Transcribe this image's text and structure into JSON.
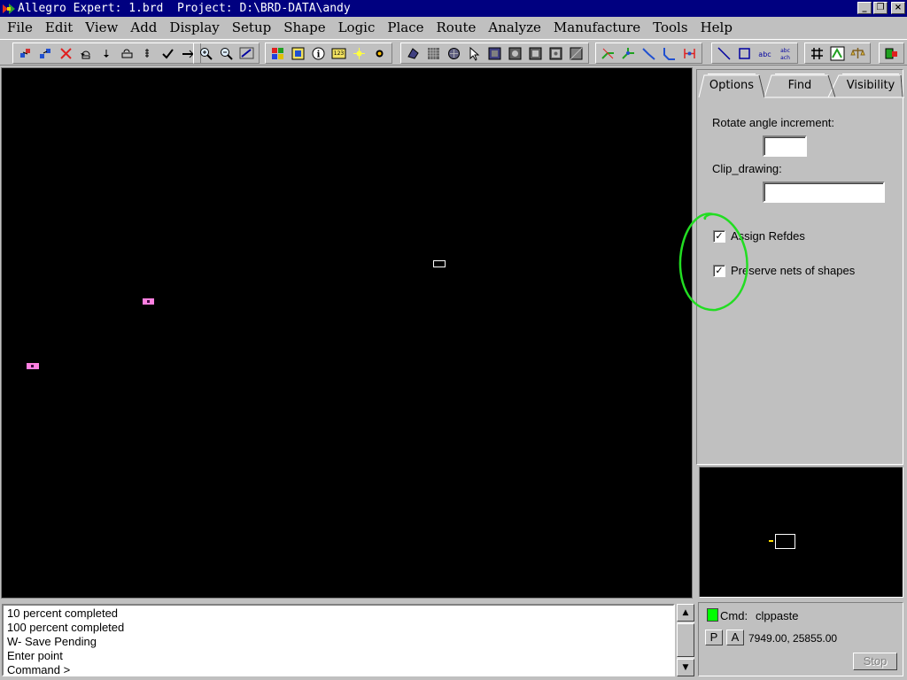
{
  "window": {
    "title": "Allegro Expert: 1.brd  Project: D:\\BRD-DATA\\andy",
    "controls": [
      "_",
      "❐",
      "×"
    ]
  },
  "menu": [
    "File",
    "Edit",
    "View",
    "Add",
    "Display",
    "Setup",
    "Shape",
    "Logic",
    "Place",
    "Route",
    "Analyze",
    "Manufacture",
    "Tools",
    "Help"
  ],
  "toolbar": {
    "groups": [
      [
        "move-icon",
        "copy-icon",
        "delete-icon",
        "undo-icon",
        "redo-icon",
        "undo-list-icon",
        "redo-list-icon",
        "done-icon",
        "next-icon"
      ],
      [
        "zoom-in-icon",
        "zoom-out-icon",
        "zoom-fit-icon"
      ],
      [
        "color-icon",
        "layers-icon",
        "info-icon",
        "measure-icon",
        "highlight-icon",
        "dehighlight-icon"
      ],
      [
        "shape-icon",
        "grid-icon",
        "via-icon",
        "select-icon",
        "fill-icon",
        "void-icon",
        "void-rect-icon",
        "void-circle-icon",
        "merge-icon"
      ],
      [
        "route-icon",
        "fanout-icon",
        "connect-icon",
        "slide-icon",
        "spread-icon"
      ],
      [
        "line-icon",
        "rect-icon",
        "text-icon",
        "text-edit-icon"
      ],
      [
        "grid-toggle-icon",
        "drc-icon",
        "scale-icon"
      ],
      [
        "exit-icon"
      ]
    ]
  },
  "options_panel": {
    "tabs": [
      "Options",
      "Find",
      "Visibility"
    ],
    "active_tab": "Options",
    "rotate_label": "Rotate angle increment:",
    "rotate_value": "",
    "clip_label": "Clip_drawing:",
    "clip_value": "",
    "assign_refdes_label": "Assign Refdes",
    "assign_refdes_checked": true,
    "preserve_nets_label": "Preserve nets of shapes",
    "preserve_nets_checked": true,
    "check_mark": "✓",
    "annotation_color": "#22dd22"
  },
  "console": {
    "lines": [
      "10 percent completed",
      "100 percent completed",
      "W- Save Pending",
      "Enter point",
      "Command >"
    ]
  },
  "status": {
    "cmd_label": "Cmd:",
    "cmd_value": "clppaste",
    "indicator_color": "#00ff00",
    "p_button": "P",
    "a_button": "A",
    "coordinates": "7949.00, 25855.00",
    "stop_button": "Stop"
  }
}
